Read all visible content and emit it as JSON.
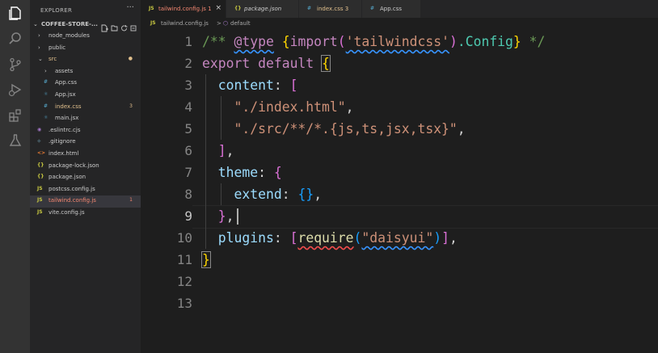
{
  "explorer": {
    "title": "EXPLORER",
    "more": "···",
    "folder": "COFFEE-STORE-...",
    "items": [
      {
        "label": "node_modules",
        "kind": "folder",
        "depth": 1,
        "chev": "›"
      },
      {
        "label": "public",
        "kind": "folder",
        "depth": 1,
        "chev": "›"
      },
      {
        "label": "src",
        "kind": "folder",
        "depth": 1,
        "chev": "⌄",
        "color": "#e2c08d",
        "badge": "●"
      },
      {
        "label": "assets",
        "kind": "folder",
        "depth": 2,
        "chev": "›"
      },
      {
        "label": "App.css",
        "kind": "file",
        "depth": 2,
        "icon": "#",
        "iconColor": "#519aba"
      },
      {
        "label": "App.jsx",
        "kind": "file",
        "depth": 2,
        "icon": "⚛",
        "iconColor": "#519aba"
      },
      {
        "label": "index.css",
        "kind": "file",
        "depth": 2,
        "icon": "#",
        "iconColor": "#519aba",
        "color": "#e2c08d",
        "badge": "3"
      },
      {
        "label": "main.jsx",
        "kind": "file",
        "depth": 2,
        "icon": "⚛",
        "iconColor": "#519aba"
      },
      {
        "label": ".eslintrc.cjs",
        "kind": "file",
        "depth": 1,
        "icon": "◉",
        "iconColor": "#a074c4"
      },
      {
        "label": ".gitignore",
        "kind": "file",
        "depth": 1,
        "icon": "◆",
        "iconColor": "#41535b"
      },
      {
        "label": "index.html",
        "kind": "file",
        "depth": 1,
        "icon": "<>",
        "iconColor": "#e37933"
      },
      {
        "label": "package-lock.json",
        "kind": "file",
        "depth": 1,
        "icon": "{}",
        "iconColor": "#cbcb41"
      },
      {
        "label": "package.json",
        "kind": "file",
        "depth": 1,
        "icon": "{}",
        "iconColor": "#cbcb41"
      },
      {
        "label": "postcss.config.js",
        "kind": "file",
        "depth": 1,
        "icon": "JS",
        "iconColor": "#cbcb41"
      },
      {
        "label": "tailwind.config.js",
        "kind": "file",
        "depth": 1,
        "icon": "JS",
        "iconColor": "#cbcb41",
        "color": "#f48771",
        "badge": "1",
        "selected": true
      },
      {
        "label": "vite.config.js",
        "kind": "file",
        "depth": 1,
        "icon": "JS",
        "iconColor": "#cbcb41"
      }
    ]
  },
  "tabs": [
    {
      "label": "tailwind.config.js 1",
      "icon": "JS",
      "iconColor": "#cbcb41",
      "color": "#f48771",
      "active": true,
      "close": "×"
    },
    {
      "label": "package.json",
      "icon": "{}",
      "iconColor": "#cbcb41",
      "color": "#cccccc",
      "italic": true
    },
    {
      "label": "index.css 3",
      "icon": "#",
      "iconColor": "#519aba",
      "color": "#e2c08d"
    },
    {
      "label": "App.css",
      "icon": "#",
      "iconColor": "#519aba",
      "color": "#cccccc"
    }
  ],
  "breadcrumb": {
    "icon": "JS",
    "file": "tailwind.config.js",
    "sep": ">",
    "symbol": "default"
  },
  "line_numbers": [
    "1",
    "2",
    "3",
    "4",
    "5",
    "6",
    "7",
    "8",
    "9",
    "10",
    "11",
    "12",
    "13"
  ],
  "current_line": "9",
  "code": {
    "l1": {
      "open": "/** ",
      "at": "@type",
      "brace1": "{",
      "imp": "import",
      "p1": "(",
      "str": "'tailwindcss'",
      "p2": ")",
      "cfg": ".Config",
      "brace2": "}",
      "close": " */"
    },
    "l2": {
      "kw1": "export",
      "kw2": "default",
      "brace": "{"
    },
    "l3": {
      "prop": "content",
      "colon": ": ",
      "br": "["
    },
    "l4": {
      "str": "\"./index.html\"",
      "comma": ","
    },
    "l5": {
      "str": "\"./src/**/*.{js,ts,jsx,tsx}\"",
      "comma": ","
    },
    "l6": {
      "br": "]",
      "comma": ","
    },
    "l7": {
      "prop": "theme",
      "colon": ": ",
      "br": "{"
    },
    "l8": {
      "prop": "extend",
      "colon": ": ",
      "br": "{}",
      "comma": ","
    },
    "l9": {
      "br": "}",
      "comma": ","
    },
    "l10": {
      "prop": "plugins",
      "colon": ": ",
      "br1": "[",
      "fn": "require",
      "p1": "(",
      "str": "\"daisyui\"",
      "p2": ")",
      "br2": "]",
      "comma": ","
    },
    "l11": {
      "brace": "}"
    }
  }
}
